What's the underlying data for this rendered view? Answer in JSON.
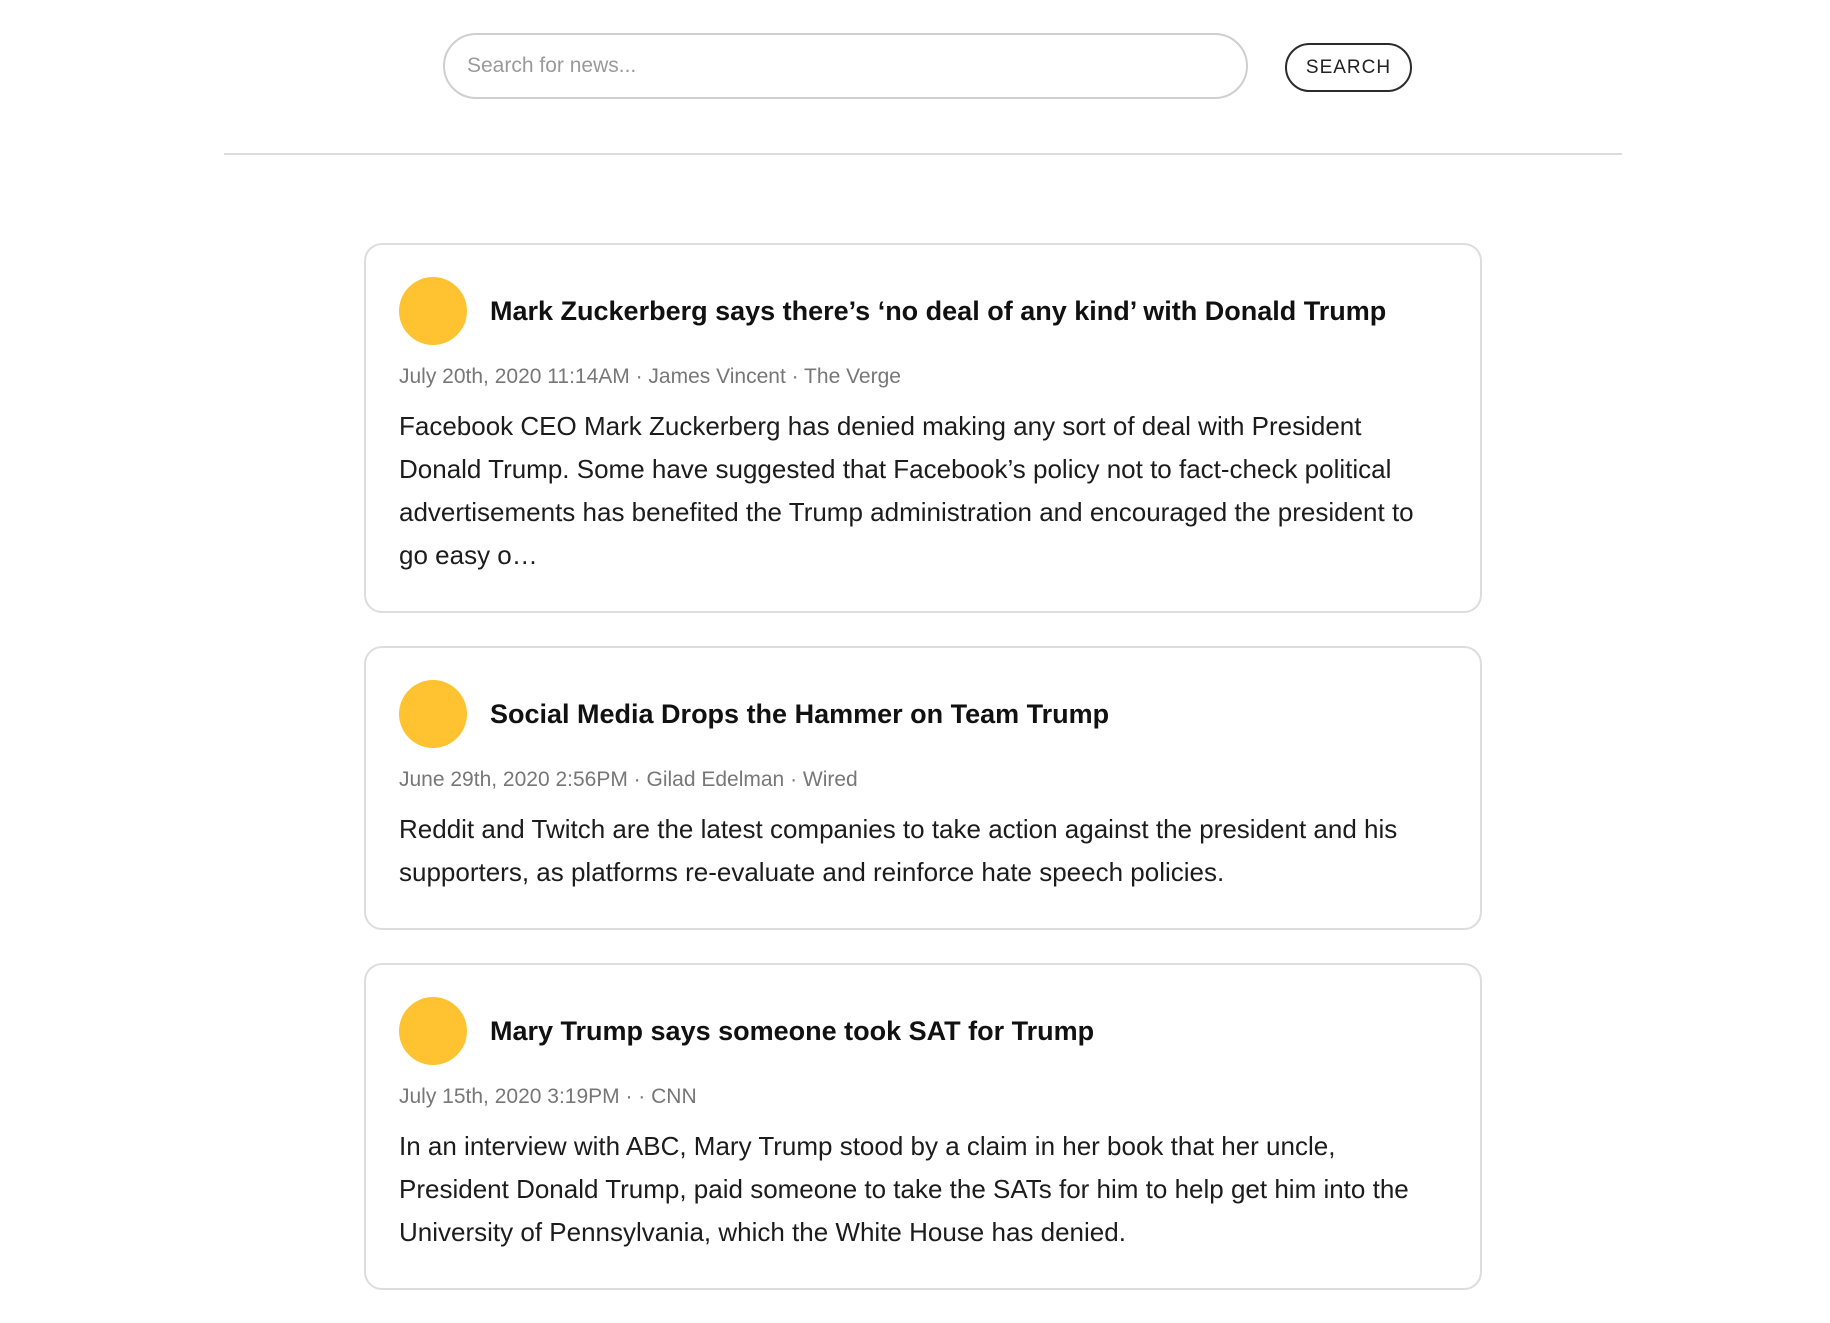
{
  "search": {
    "placeholder": "Search for news...",
    "value": "",
    "button_label": "SEARCH"
  },
  "colors": {
    "avatar": "#FFC230",
    "card_border": "#DDDDDD",
    "meta_text": "#777777"
  },
  "articles": [
    {
      "title": "Mark Zuckerberg says there’s ‘no deal of any kind’ with Donald Trump",
      "meta": "July 20th, 2020 11:14AM · James Vincent · The Verge",
      "description": "Facebook CEO Mark Zuckerberg has denied making any sort of deal with President Donald Trump. Some have suggested that Facebook’s policy not to fact-check political advertisements has benefited the Trump administration and encouraged the president to go easy o…"
    },
    {
      "title": "Social Media Drops the Hammer on Team Trump",
      "meta": "June 29th, 2020 2:56PM · Gilad Edelman · Wired",
      "description": "Reddit and Twitch are the latest companies to take action against the president and his supporters, as platforms re-evaluate and reinforce hate speech policies."
    },
    {
      "title": "Mary Trump says someone took SAT for Trump",
      "meta": "July 15th, 2020 3:19PM · · CNN",
      "description": "In an interview with ABC, Mary Trump stood by a claim in her book that her uncle, President Donald Trump, paid someone to take the SATs for him to help get him into the University of Pennsylvania, which the White House has denied."
    }
  ]
}
